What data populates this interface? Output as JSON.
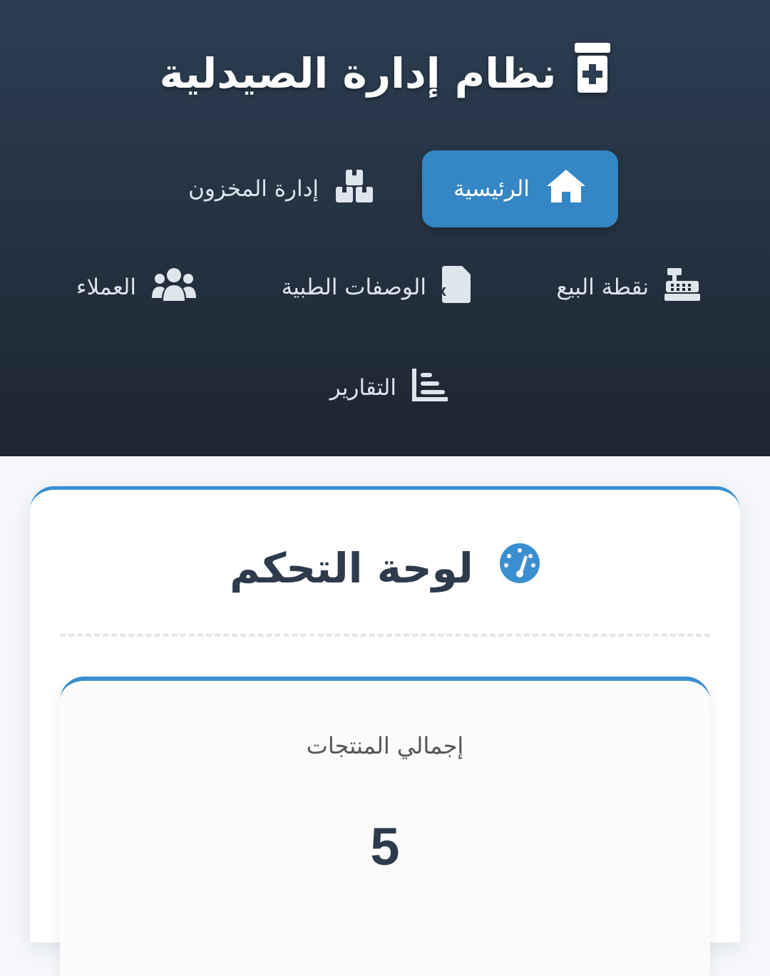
{
  "app": {
    "title": "نظام إدارة الصيدلية",
    "icon": "prescription-bottle-medical-icon"
  },
  "nav": {
    "home": {
      "label": "الرئيسية",
      "icon": "home-icon",
      "active": true
    },
    "inventory": {
      "label": "إدارة المخزون",
      "icon": "boxes-icon"
    },
    "pos": {
      "label": "نقطة البيع",
      "icon": "cash-register-icon"
    },
    "prescriptions": {
      "label": "الوصفات الطبية",
      "icon": "prescription-file-icon"
    },
    "customers": {
      "label": "العملاء",
      "icon": "users-icon"
    },
    "reports": {
      "label": "التقارير",
      "icon": "chart-icon"
    }
  },
  "dashboard": {
    "title": "لوحة التحكم",
    "icon": "gauge-icon",
    "stats": [
      {
        "label": "إجمالي المنتجات",
        "value": "5"
      }
    ]
  },
  "colors": {
    "header_top": "#2c3e52",
    "header_bottom": "#1d2631",
    "accent": "#3586c4",
    "text_dark": "#2d3b4c"
  }
}
